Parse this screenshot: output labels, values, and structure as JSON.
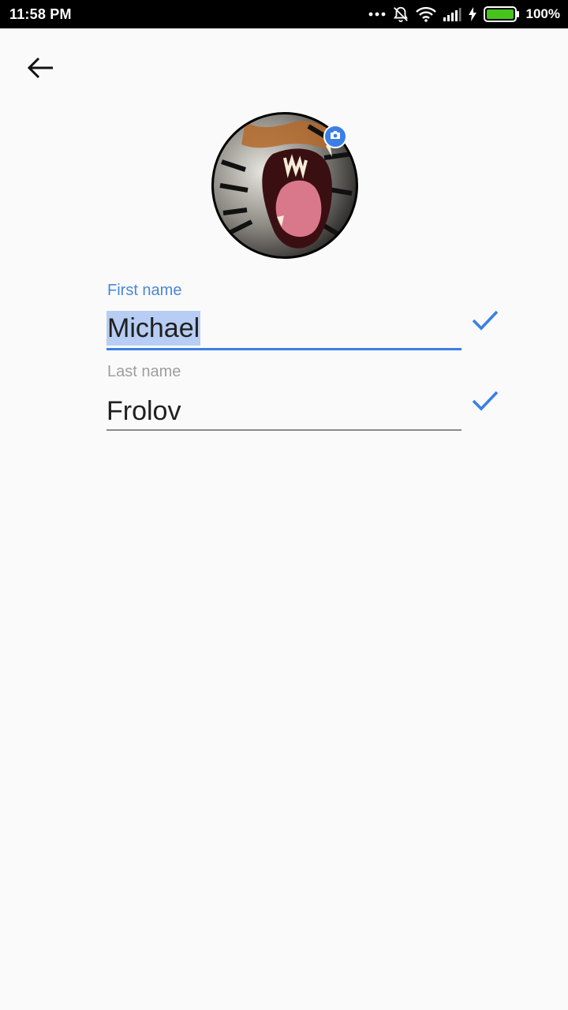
{
  "status_bar": {
    "time": "11:58 PM",
    "battery": "100%",
    "icons": [
      "more-dots-icon",
      "bell-off-icon",
      "wifi-icon",
      "signal-icon",
      "charging-icon",
      "battery-icon"
    ]
  },
  "header": {
    "back_icon": "arrow-left-icon"
  },
  "profile": {
    "avatar_alt": "profile photo",
    "camera_icon": "camera-icon"
  },
  "form": {
    "first_name": {
      "label": "First name",
      "value": "Michael",
      "focused": true
    },
    "last_name": {
      "label": "Last name",
      "value": "Frolov",
      "focused": false
    },
    "confirm_icon": "checkmark-icon"
  },
  "colors": {
    "accent": "#3b7fe6",
    "label_focused": "#4a87d8",
    "label_idle": "#9e9e9e",
    "background": "#fafafa"
  }
}
